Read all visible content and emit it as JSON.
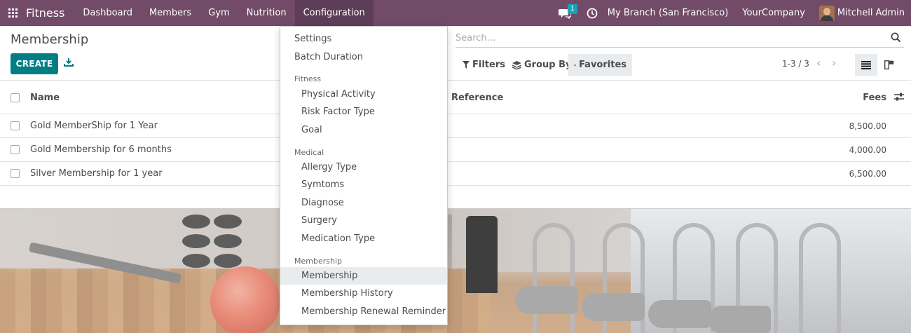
{
  "navbar": {
    "app_name": "Fitness",
    "menu": [
      "Dashboard",
      "Members",
      "Gym",
      "Nutrition",
      "Configuration"
    ],
    "chat_count": "1",
    "branch": "My Branch (San Francisco)",
    "company": "YourCompany",
    "user": "Mitchell Admin"
  },
  "control": {
    "title": "Membership",
    "create_label": "CREATE",
    "search_placeholder": "Search...",
    "filters_label": "Filters",
    "groupby_label": "Group By",
    "favorites_label": "Favorites",
    "pager": "1-3 / 3"
  },
  "table": {
    "headers": {
      "name": "Name",
      "reference": "Reference",
      "fees": "Fees"
    },
    "rows": [
      {
        "name": "Gold MemberShip for 1 Year",
        "fees": "8,500.00"
      },
      {
        "name": "Gold Membership for 6 months",
        "fees": "4,000.00"
      },
      {
        "name": "Silver Membership for 1 year",
        "fees": "6,500.00"
      }
    ]
  },
  "dropdown": {
    "top_items": [
      "Settings",
      "Batch Duration"
    ],
    "sections": [
      {
        "header": "Fitness",
        "items": [
          "Physical Activity",
          "Risk Factor Type",
          "Goal"
        ]
      },
      {
        "header": "Medical",
        "items": [
          "Allergy Type",
          "Symtoms",
          "Diagnose",
          "Surgery",
          "Medication Type"
        ]
      },
      {
        "header": "Membership",
        "items": [
          "Membership",
          "Membership History",
          "Membership Renewal Reminder"
        ]
      }
    ],
    "active_item": "Membership"
  },
  "colors": {
    "navbar": "#714b67",
    "primary_button": "#017e84",
    "badge": "#17a2b8"
  }
}
